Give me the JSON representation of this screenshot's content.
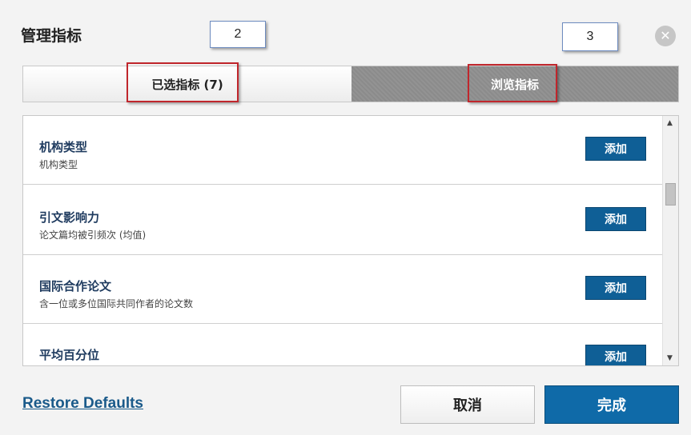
{
  "dialog": {
    "title": "管理指标",
    "close_icon": "close-icon"
  },
  "callouts": {
    "first": "2",
    "second": "3"
  },
  "tabs": {
    "selected_label": "已选指标 (7)",
    "browse_label": "浏览指标"
  },
  "metrics": [
    {
      "title": "机构类型",
      "description": "机构类型",
      "add_label": "添加"
    },
    {
      "title": "引文影响力",
      "description": "论文篇均被引频次 (均值)",
      "add_label": "添加"
    },
    {
      "title": "国际合作论文",
      "description": "含一位或多位国际共同作者的论文数",
      "add_label": "添加"
    },
    {
      "title": "平均百分位",
      "description": "",
      "add_label": "添加"
    }
  ],
  "footer": {
    "restore_label": "Restore Defaults",
    "cancel_label": "取消",
    "done_label": "完成"
  },
  "colors": {
    "primary_button": "#0f6aa8",
    "add_button": "#0f5f96",
    "active_tab": "#8f8f8f",
    "highlight": "#c0262c"
  }
}
